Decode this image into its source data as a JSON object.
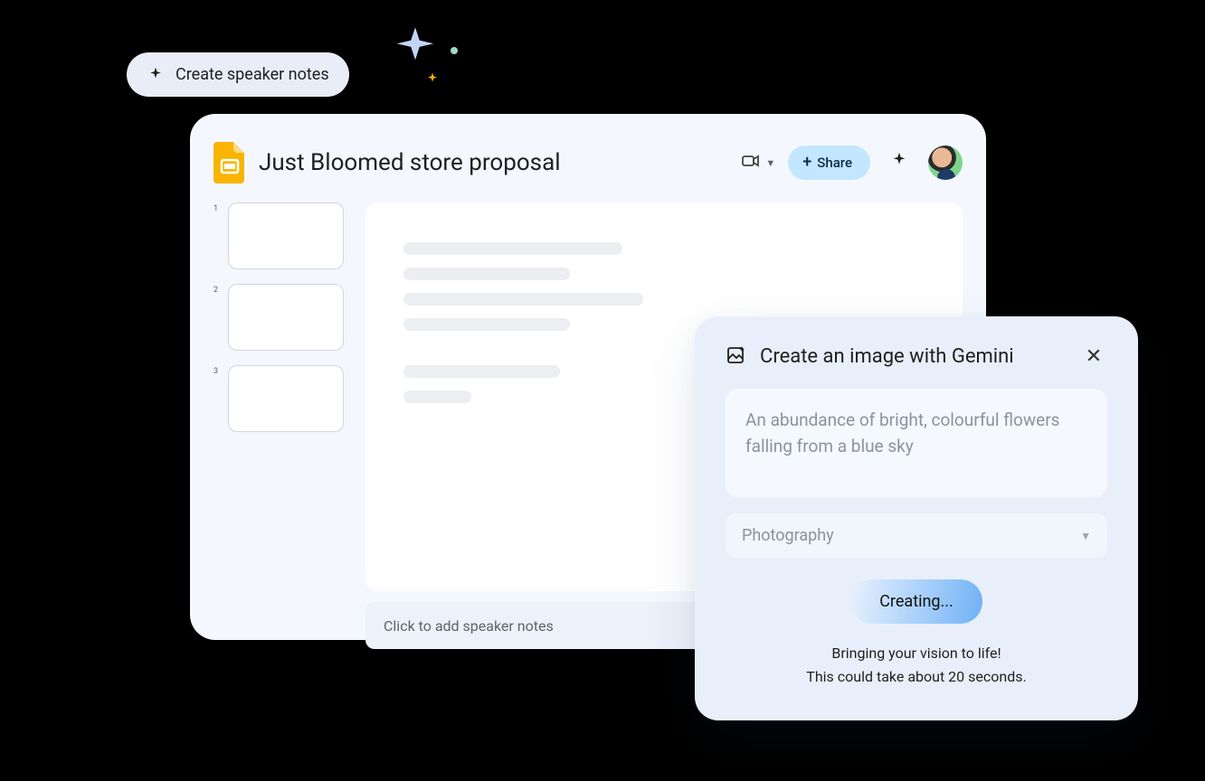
{
  "chip": {
    "label": "Create speaker notes"
  },
  "header": {
    "doc_title": "Just Bloomed store proposal",
    "share_label": "Share"
  },
  "thumbnails": [
    {
      "index": "1"
    },
    {
      "index": "2"
    },
    {
      "index": "3"
    }
  ],
  "speaker_notes_placeholder": "Click to add speaker notes",
  "gemini": {
    "title": "Create an image with Gemini",
    "prompt": "An abundance of bright, colourful flowers falling from a blue sky",
    "style": "Photography",
    "button_label": "Creating...",
    "status_line1": "Bringing your vision to life!",
    "status_line2": "This could take about 20 seconds."
  }
}
